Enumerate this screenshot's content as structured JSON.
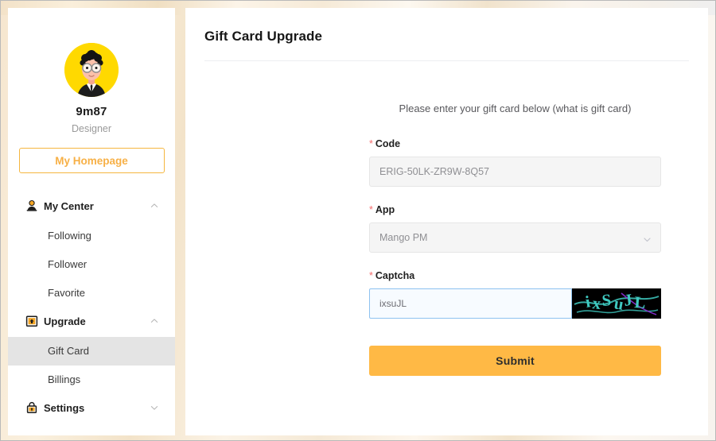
{
  "theme": {
    "accent": "#f7b046",
    "submit_bg": "#ffb945",
    "required_star": "#f56c6c",
    "active_item_bg": "#e4e4e4",
    "avatar_bg": "#ffd900",
    "captcha_bg": "#000000",
    "captcha_fg": "#3fc9c0",
    "focus_border": "#8ec2f0"
  },
  "sidebar": {
    "avatar_name": "user-avatar",
    "username": "9m87",
    "role": "Designer",
    "homepage_button": "My Homepage",
    "groups": [
      {
        "id": "my-center",
        "label": "My Center",
        "icon": "user-icon",
        "expanded": true,
        "chevron": "chevron-up",
        "items": [
          {
            "label": "Following",
            "active": false
          },
          {
            "label": "Follower",
            "active": false
          },
          {
            "label": "Favorite",
            "active": false
          }
        ]
      },
      {
        "id": "upgrade",
        "label": "Upgrade",
        "icon": "upgrade-box-icon",
        "expanded": true,
        "chevron": "chevron-up",
        "items": [
          {
            "label": "Gift Card",
            "active": true
          },
          {
            "label": "Billings",
            "active": false
          }
        ]
      },
      {
        "id": "settings",
        "label": "Settings",
        "icon": "lock-icon",
        "expanded": false,
        "chevron": "chevron-down",
        "items": []
      }
    ]
  },
  "main": {
    "page_title": "Gift Card Upgrade"
  },
  "form": {
    "hint": "Please enter your gift card below (what is gift card)",
    "required_marker": "*",
    "code": {
      "label": "Code",
      "value": "ERIG-50LK-ZR9W-8Q57",
      "placeholder": "ERIG-50LK-ZR9W-8Q57"
    },
    "app": {
      "label": "App",
      "value": "Mango PM",
      "options": [
        "Mango PM"
      ],
      "arrow_icon": "chevron-down-icon"
    },
    "captcha": {
      "label": "Captcha",
      "value": "ixsuJL",
      "image_text": "ixSuJL",
      "image_name": "captcha-image"
    },
    "submit_label": "Submit"
  }
}
